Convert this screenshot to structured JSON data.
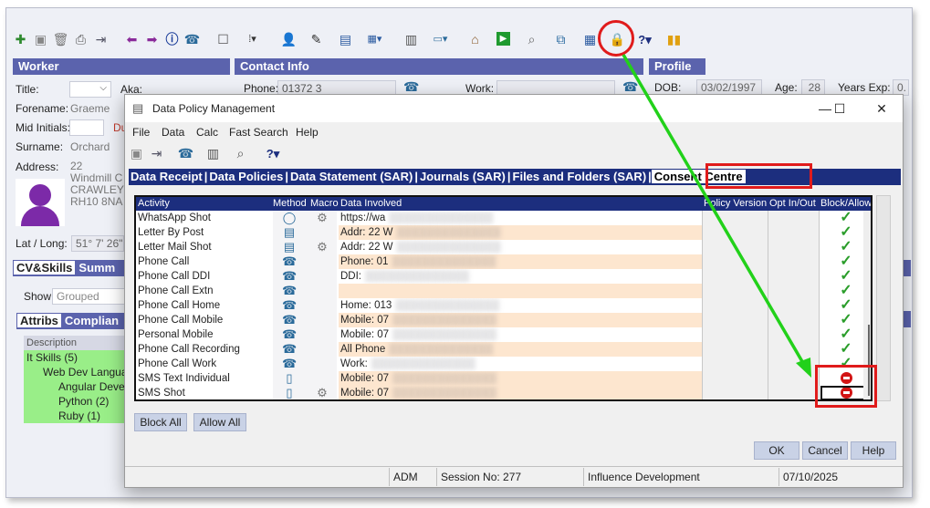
{
  "toolbar": {
    "icons": [
      "new-record-icon",
      "save-icon",
      "delete-icon",
      "print-icon",
      "export-icon",
      "back-arrow-icon",
      "forward-arrow-icon",
      "info-icon",
      "phone-icon",
      "blank-icon",
      "menu-grid-icon",
      "person-icon",
      "pen-icon",
      "document-icon",
      "calendar-icon",
      "calculator-icon",
      "notes-icon",
      "home-icon",
      "play-icon",
      "search-icon",
      "hierarchy-icon",
      "table-icon",
      "data-policy-lock-icon",
      "help-icon",
      "chart-icon"
    ]
  },
  "worker": {
    "header": "Worker",
    "title_label": "Title:",
    "aka_label": "Aka:",
    "forename_label": "Forename:",
    "forename_value": "Graeme",
    "mid_initials_label": "Mid Initials:",
    "surname_label": "Surname:",
    "surname_value": "Orchard",
    "address_label": "Address:",
    "address_lines": [
      "22 Windmill C",
      "CRAWLEY",
      "RH10 8NA"
    ],
    "latlong_label": "Lat / Long:",
    "latlong_value": "51° 7' 26\"",
    "fragment_du": "Du"
  },
  "contact": {
    "header": "Contact Info",
    "phone_label": "Phone:",
    "phone_value": "01372 3",
    "work_label": "Work:"
  },
  "profile": {
    "header": "Profile",
    "dob_label": "DOB:",
    "dob_value": "03/02/1997",
    "age_label": "Age:",
    "age_value": "28",
    "years_exp_label": "Years Exp:",
    "years_exp_value": "0."
  },
  "cvskills": {
    "tabs": [
      "CV&Skills",
      "Summ"
    ],
    "show_label": "Show",
    "show_value": "Grouped",
    "attrib_tabs": [
      "Attribs",
      "Complian"
    ],
    "description_header": "Description",
    "tree": [
      {
        "label": "It Skills  (5)",
        "level": 0
      },
      {
        "label": "Web Dev Languag",
        "level": 1
      },
      {
        "label": "Angular Develo",
        "level": 2
      },
      {
        "label": "Python  (2)",
        "level": 2
      },
      {
        "label": "Ruby  (1)",
        "level": 2
      }
    ]
  },
  "dialog": {
    "title": "Data Policy Management",
    "win_min": "—",
    "win_max": "☐",
    "win_close": "✕",
    "menu": [
      "File",
      "Data",
      "Calc",
      "Fast Search",
      "Help"
    ],
    "tabs": [
      "Data Receipt",
      "Data Policies",
      "Data Statement (SAR)",
      "Journals (SAR)",
      "Files and Folders (SAR)",
      "Consent Centre"
    ],
    "selected_tab": "Consent Centre",
    "columns": [
      "Activity",
      "Method",
      "Macro",
      "Data Involved",
      "Policy Version",
      "Opt In/Out",
      "Block/Allow"
    ],
    "rows": [
      {
        "activity": "WhatsApp Shot",
        "method": "whatsapp",
        "macro": true,
        "data": "https://wa",
        "status": "allow"
      },
      {
        "activity": "Letter By Post",
        "method": "word",
        "macro": false,
        "data": "Addr: 22 W",
        "status": "allow"
      },
      {
        "activity": "Letter Mail Shot",
        "method": "word",
        "macro": true,
        "data": "Addr: 22 W",
        "status": "allow"
      },
      {
        "activity": "Phone Call",
        "method": "phone",
        "macro": false,
        "data": "Phone: 01",
        "status": "allow"
      },
      {
        "activity": "Phone Call DDI",
        "method": "phone",
        "macro": false,
        "data": "DDI:",
        "status": "allow"
      },
      {
        "activity": "Phone Call Extn",
        "method": "phone",
        "macro": false,
        "data": "",
        "status": "allow"
      },
      {
        "activity": "Phone Call Home",
        "method": "phone",
        "macro": false,
        "data": "Home: 013",
        "status": "allow"
      },
      {
        "activity": "Phone Call Mobile",
        "method": "phone",
        "macro": false,
        "data": "Mobile: 07",
        "status": "allow"
      },
      {
        "activity": "Personal Mobile",
        "method": "phone",
        "macro": false,
        "data": "Mobile: 07",
        "status": "allow"
      },
      {
        "activity": "Phone Call Recording",
        "method": "phone",
        "macro": false,
        "data": "All Phone",
        "status": "allow"
      },
      {
        "activity": "Phone Call Work",
        "method": "phone",
        "macro": false,
        "data": "Work:",
        "status": "allow"
      },
      {
        "activity": "SMS Text Individual",
        "method": "mobile",
        "macro": false,
        "data": "Mobile: 07",
        "status": "block"
      },
      {
        "activity": "SMS Shot",
        "method": "mobile",
        "macro": true,
        "data": "Mobile: 07",
        "status": "block"
      }
    ],
    "block_all": "Block All",
    "allow_all": "Allow All",
    "ok": "OK",
    "cancel": "Cancel",
    "help": "Help",
    "status_bar": {
      "user": "ADM",
      "session": "Session No: 277",
      "company": "Influence Development",
      "date": "07/10/2025"
    }
  },
  "colors": {
    "section_header": "#5b63ad",
    "dialog_tab_bar": "#1c2e7e",
    "row_highlight": "#fde6cf",
    "tree_highlight": "#99ee88",
    "annotation_red": "#e01b1b",
    "annotation_green": "#22d11a",
    "allow_check": "#2a9d2a",
    "block_red": "#d21414"
  }
}
